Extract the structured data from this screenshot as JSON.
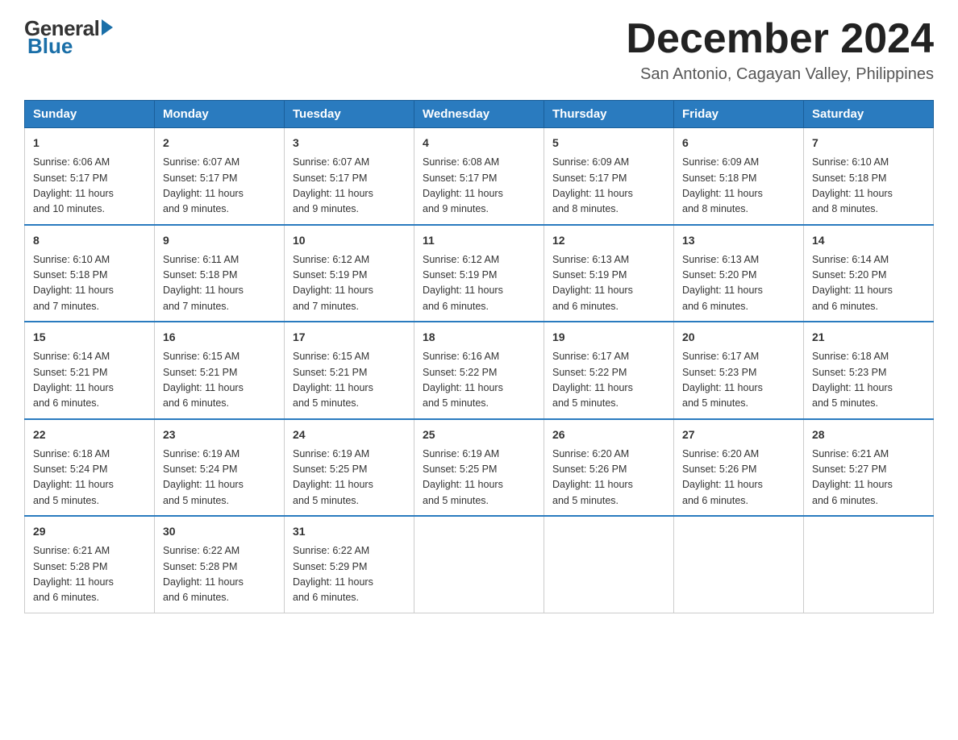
{
  "logo": {
    "general": "General",
    "blue": "Blue"
  },
  "title": {
    "month": "December 2024",
    "location": "San Antonio, Cagayan Valley, Philippines"
  },
  "days_header": [
    "Sunday",
    "Monday",
    "Tuesday",
    "Wednesday",
    "Thursday",
    "Friday",
    "Saturday"
  ],
  "weeks": [
    [
      {
        "num": "1",
        "sunrise": "6:06 AM",
        "sunset": "5:17 PM",
        "daylight": "11 hours and 10 minutes."
      },
      {
        "num": "2",
        "sunrise": "6:07 AM",
        "sunset": "5:17 PM",
        "daylight": "11 hours and 9 minutes."
      },
      {
        "num": "3",
        "sunrise": "6:07 AM",
        "sunset": "5:17 PM",
        "daylight": "11 hours and 9 minutes."
      },
      {
        "num": "4",
        "sunrise": "6:08 AM",
        "sunset": "5:17 PM",
        "daylight": "11 hours and 9 minutes."
      },
      {
        "num": "5",
        "sunrise": "6:09 AM",
        "sunset": "5:17 PM",
        "daylight": "11 hours and 8 minutes."
      },
      {
        "num": "6",
        "sunrise": "6:09 AM",
        "sunset": "5:18 PM",
        "daylight": "11 hours and 8 minutes."
      },
      {
        "num": "7",
        "sunrise": "6:10 AM",
        "sunset": "5:18 PM",
        "daylight": "11 hours and 8 minutes."
      }
    ],
    [
      {
        "num": "8",
        "sunrise": "6:10 AM",
        "sunset": "5:18 PM",
        "daylight": "11 hours and 7 minutes."
      },
      {
        "num": "9",
        "sunrise": "6:11 AM",
        "sunset": "5:18 PM",
        "daylight": "11 hours and 7 minutes."
      },
      {
        "num": "10",
        "sunrise": "6:12 AM",
        "sunset": "5:19 PM",
        "daylight": "11 hours and 7 minutes."
      },
      {
        "num": "11",
        "sunrise": "6:12 AM",
        "sunset": "5:19 PM",
        "daylight": "11 hours and 6 minutes."
      },
      {
        "num": "12",
        "sunrise": "6:13 AM",
        "sunset": "5:19 PM",
        "daylight": "11 hours and 6 minutes."
      },
      {
        "num": "13",
        "sunrise": "6:13 AM",
        "sunset": "5:20 PM",
        "daylight": "11 hours and 6 minutes."
      },
      {
        "num": "14",
        "sunrise": "6:14 AM",
        "sunset": "5:20 PM",
        "daylight": "11 hours and 6 minutes."
      }
    ],
    [
      {
        "num": "15",
        "sunrise": "6:14 AM",
        "sunset": "5:21 PM",
        "daylight": "11 hours and 6 minutes."
      },
      {
        "num": "16",
        "sunrise": "6:15 AM",
        "sunset": "5:21 PM",
        "daylight": "11 hours and 6 minutes."
      },
      {
        "num": "17",
        "sunrise": "6:15 AM",
        "sunset": "5:21 PM",
        "daylight": "11 hours and 5 minutes."
      },
      {
        "num": "18",
        "sunrise": "6:16 AM",
        "sunset": "5:22 PM",
        "daylight": "11 hours and 5 minutes."
      },
      {
        "num": "19",
        "sunrise": "6:17 AM",
        "sunset": "5:22 PM",
        "daylight": "11 hours and 5 minutes."
      },
      {
        "num": "20",
        "sunrise": "6:17 AM",
        "sunset": "5:23 PM",
        "daylight": "11 hours and 5 minutes."
      },
      {
        "num": "21",
        "sunrise": "6:18 AM",
        "sunset": "5:23 PM",
        "daylight": "11 hours and 5 minutes."
      }
    ],
    [
      {
        "num": "22",
        "sunrise": "6:18 AM",
        "sunset": "5:24 PM",
        "daylight": "11 hours and 5 minutes."
      },
      {
        "num": "23",
        "sunrise": "6:19 AM",
        "sunset": "5:24 PM",
        "daylight": "11 hours and 5 minutes."
      },
      {
        "num": "24",
        "sunrise": "6:19 AM",
        "sunset": "5:25 PM",
        "daylight": "11 hours and 5 minutes."
      },
      {
        "num": "25",
        "sunrise": "6:19 AM",
        "sunset": "5:25 PM",
        "daylight": "11 hours and 5 minutes."
      },
      {
        "num": "26",
        "sunrise": "6:20 AM",
        "sunset": "5:26 PM",
        "daylight": "11 hours and 5 minutes."
      },
      {
        "num": "27",
        "sunrise": "6:20 AM",
        "sunset": "5:26 PM",
        "daylight": "11 hours and 6 minutes."
      },
      {
        "num": "28",
        "sunrise": "6:21 AM",
        "sunset": "5:27 PM",
        "daylight": "11 hours and 6 minutes."
      }
    ],
    [
      {
        "num": "29",
        "sunrise": "6:21 AM",
        "sunset": "5:28 PM",
        "daylight": "11 hours and 6 minutes."
      },
      {
        "num": "30",
        "sunrise": "6:22 AM",
        "sunset": "5:28 PM",
        "daylight": "11 hours and 6 minutes."
      },
      {
        "num": "31",
        "sunrise": "6:22 AM",
        "sunset": "5:29 PM",
        "daylight": "11 hours and 6 minutes."
      },
      null,
      null,
      null,
      null
    ]
  ]
}
